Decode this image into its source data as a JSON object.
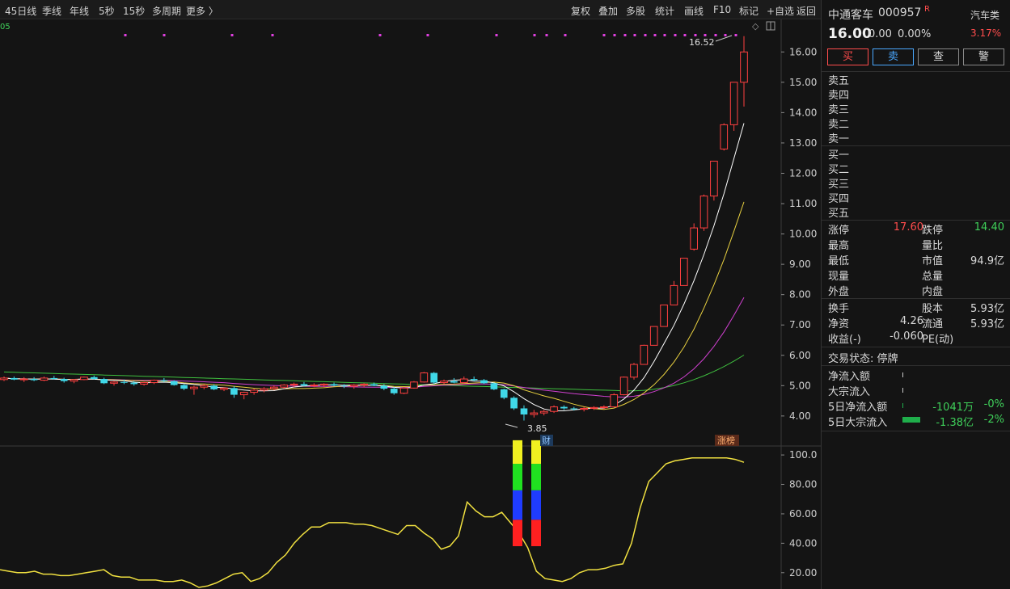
{
  "toolbar": {
    "left_items": [
      "45日线",
      "季线",
      "年线",
      "5秒",
      "15秒",
      "多周期",
      "更多 〉"
    ],
    "right_items": [
      "复权",
      "叠加",
      "多股",
      "统计",
      "画线",
      "F10",
      "标记",
      "+自选",
      "返回"
    ]
  },
  "chart": {
    "corner_label": "05",
    "price_axis": [
      "16.00",
      "15.00",
      "14.00",
      "13.00",
      "12.00",
      "11.00",
      "10.00",
      "9.00",
      "8.00",
      "7.00",
      "6.00",
      "5.00",
      "4.00"
    ],
    "price_range": [
      3.65,
      16.7
    ],
    "high_annotation": "16.52",
    "low_annotation": "3.85",
    "cai_badge": "财",
    "zhangting_badge": "涨榜",
    "indicator_axis": [
      "100.0",
      "80.00",
      "60.00",
      "40.00",
      "20.00"
    ],
    "indicator_range": [
      10,
      105
    ]
  },
  "chart_data": {
    "type": "candlestick",
    "candles": [
      [
        5.2,
        5.3,
        5.15,
        5.25
      ],
      [
        5.25,
        5.3,
        5.18,
        5.2
      ],
      [
        5.2,
        5.28,
        5.12,
        5.22
      ],
      [
        5.22,
        5.28,
        5.15,
        5.18
      ],
      [
        5.18,
        5.3,
        5.15,
        5.25
      ],
      [
        5.25,
        5.32,
        5.2,
        5.22
      ],
      [
        5.22,
        5.26,
        5.1,
        5.15
      ],
      [
        5.15,
        5.22,
        5.08,
        5.2
      ],
      [
        5.2,
        5.3,
        5.18,
        5.28
      ],
      [
        5.28,
        5.33,
        5.2,
        5.22
      ],
      [
        5.22,
        5.26,
        5.05,
        5.08
      ],
      [
        5.08,
        5.15,
        5.0,
        5.12
      ],
      [
        5.12,
        5.2,
        5.05,
        5.1
      ],
      [
        5.1,
        5.15,
        5.0,
        5.05
      ],
      [
        5.05,
        5.12,
        5.0,
        5.1
      ],
      [
        5.1,
        5.2,
        5.05,
        5.18
      ],
      [
        5.18,
        5.25,
        5.12,
        5.15
      ],
      [
        5.15,
        5.18,
        5.0,
        5.02
      ],
      [
        5.02,
        5.05,
        4.85,
        4.9
      ],
      [
        4.9,
        5.0,
        4.7,
        4.95
      ],
      [
        4.95,
        5.05,
        4.88,
        5.0
      ],
      [
        5.0,
        5.05,
        4.85,
        4.88
      ],
      [
        4.88,
        4.95,
        4.82,
        4.92
      ],
      [
        4.92,
        4.98,
        4.6,
        4.7
      ],
      [
        4.7,
        4.8,
        4.55,
        4.78
      ],
      [
        4.78,
        4.9,
        4.7,
        4.85
      ],
      [
        4.85,
        4.95,
        4.78,
        4.9
      ],
      [
        4.9,
        5.0,
        4.85,
        4.95
      ],
      [
        4.95,
        5.05,
        4.9,
        5.02
      ],
      [
        5.02,
        5.1,
        4.95,
        5.05
      ],
      [
        5.05,
        5.12,
        4.98,
        5.0
      ],
      [
        5.0,
        5.08,
        4.95,
        5.02
      ],
      [
        5.02,
        5.08,
        4.95,
        5.05
      ],
      [
        5.05,
        5.1,
        4.98,
        5.0
      ],
      [
        5.0,
        5.05,
        4.92,
        4.98
      ],
      [
        4.98,
        5.05,
        4.9,
        5.02
      ],
      [
        5.02,
        5.08,
        4.95,
        5.05
      ],
      [
        5.05,
        5.1,
        4.98,
        5.0
      ],
      [
        5.0,
        5.05,
        4.85,
        4.9
      ],
      [
        4.9,
        4.95,
        4.7,
        4.75
      ],
      [
        4.75,
        4.95,
        4.72,
        4.92
      ],
      [
        4.92,
        5.15,
        4.9,
        5.12
      ],
      [
        5.12,
        5.45,
        5.1,
        5.42
      ],
      [
        5.42,
        5.45,
        5.05,
        5.1
      ],
      [
        5.1,
        5.2,
        5.05,
        5.15
      ],
      [
        5.15,
        5.25,
        5.08,
        5.1
      ],
      [
        5.1,
        5.3,
        5.05,
        5.22
      ],
      [
        5.22,
        5.3,
        5.15,
        5.18
      ],
      [
        5.18,
        5.22,
        5.05,
        5.08
      ],
      [
        5.08,
        5.1,
        4.85,
        4.88
      ],
      [
        4.88,
        4.9,
        4.55,
        4.6
      ],
      [
        4.6,
        4.65,
        4.2,
        4.25
      ],
      [
        4.25,
        4.35,
        3.85,
        4.05
      ],
      [
        4.05,
        4.2,
        3.95,
        4.1
      ],
      [
        4.1,
        4.2,
        4.02,
        4.15
      ],
      [
        4.15,
        4.35,
        4.1,
        4.3
      ],
      [
        4.3,
        4.35,
        4.2,
        4.25
      ],
      [
        4.25,
        4.3,
        4.18,
        4.22
      ],
      [
        4.22,
        4.3,
        4.15,
        4.25
      ],
      [
        4.25,
        4.32,
        4.2,
        4.28
      ],
      [
        4.28,
        4.35,
        4.22,
        4.3
      ],
      [
        4.3,
        4.75,
        4.28,
        4.7
      ],
      [
        4.7,
        5.3,
        4.68,
        5.28
      ],
      [
        5.28,
        5.75,
        5.2,
        5.7
      ],
      [
        5.7,
        6.35,
        5.7,
        6.33
      ],
      [
        6.33,
        6.95,
        6.33,
        6.95
      ],
      [
        6.95,
        7.66,
        6.95,
        7.66
      ],
      [
        7.66,
        8.45,
        7.66,
        8.3
      ],
      [
        8.3,
        9.2,
        8.3,
        9.2
      ],
      [
        9.5,
        10.35,
        9.45,
        10.2
      ],
      [
        10.2,
        11.3,
        10.1,
        11.25
      ],
      [
        11.25,
        12.4,
        11.1,
        12.4
      ],
      [
        12.8,
        13.65,
        12.75,
        13.6
      ],
      [
        13.6,
        15.0,
        13.4,
        15.0
      ],
      [
        15.0,
        16.52,
        14.2,
        16.0
      ]
    ],
    "ma_series": [
      "MA5 white",
      "MA10 yellow",
      "MA20 magenta",
      "MA60 green"
    ],
    "indicator": [
      22,
      21,
      20,
      20,
      21,
      19,
      19,
      18,
      18,
      19,
      20,
      21,
      22,
      18,
      17,
      17,
      15,
      15,
      15,
      14,
      14,
      15,
      13,
      10,
      11,
      13,
      16,
      19,
      20,
      14,
      16,
      20,
      27,
      32,
      40,
      46,
      51,
      51,
      54,
      54,
      54,
      53,
      53,
      52,
      50,
      48,
      46,
      52,
      52,
      47,
      43,
      36,
      38,
      45,
      68,
      62,
      58,
      58,
      61,
      54,
      47,
      37,
      21,
      16,
      15,
      14,
      16,
      20,
      22,
      22,
      23,
      25,
      26,
      40,
      64,
      82,
      88,
      94,
      96,
      97,
      98,
      98,
      98,
      98,
      98,
      97,
      95
    ]
  },
  "panel": {
    "stock_name": "中通客车",
    "stock_code": "000957",
    "flag": "R",
    "sector": "汽车类",
    "sector_pct": "3.17%",
    "price": "16.00",
    "change": "0.00",
    "change_pct": "0.00%",
    "buttons": [
      "买",
      "卖",
      "查",
      "警"
    ],
    "sell_levels": [
      "卖五",
      "卖四",
      "卖三",
      "卖二",
      "卖一"
    ],
    "buy_levels": [
      "买一",
      "买二",
      "买三",
      "买四",
      "买五"
    ],
    "stats": {
      "limit_up_label": "涨停",
      "limit_up": "17.60",
      "limit_down_label": "跌停",
      "limit_down": "14.40",
      "high_label": "最高",
      "vol_ratio_label": "量比",
      "low_label": "最低",
      "mkt_cap_label": "市值",
      "mkt_cap": "94.9亿",
      "cur_vol_label": "现量",
      "total_vol_label": "总量",
      "outer_label": "外盘",
      "inner_label": "内盘",
      "turnover_label": "换手",
      "share_cap_label": "股本",
      "share_cap": "5.93亿",
      "nav_label": "净资",
      "nav": "4.26",
      "float_label": "流通",
      "float": "5.93亿",
      "eps_label": "收益(-)",
      "eps": "-0.060",
      "pe_label": "PE(动)"
    },
    "status_line": "交易状态: 停牌",
    "flows": [
      {
        "label": "净流入额",
        "val": "",
        "pct": ""
      },
      {
        "label": "大宗流入",
        "val": "",
        "pct": ""
      },
      {
        "label": "5日净流入额",
        "val": "-1041万",
        "pct": "-0%"
      },
      {
        "label": "5日大宗流入",
        "val": "-1.38亿",
        "pct": "-2%"
      }
    ]
  }
}
